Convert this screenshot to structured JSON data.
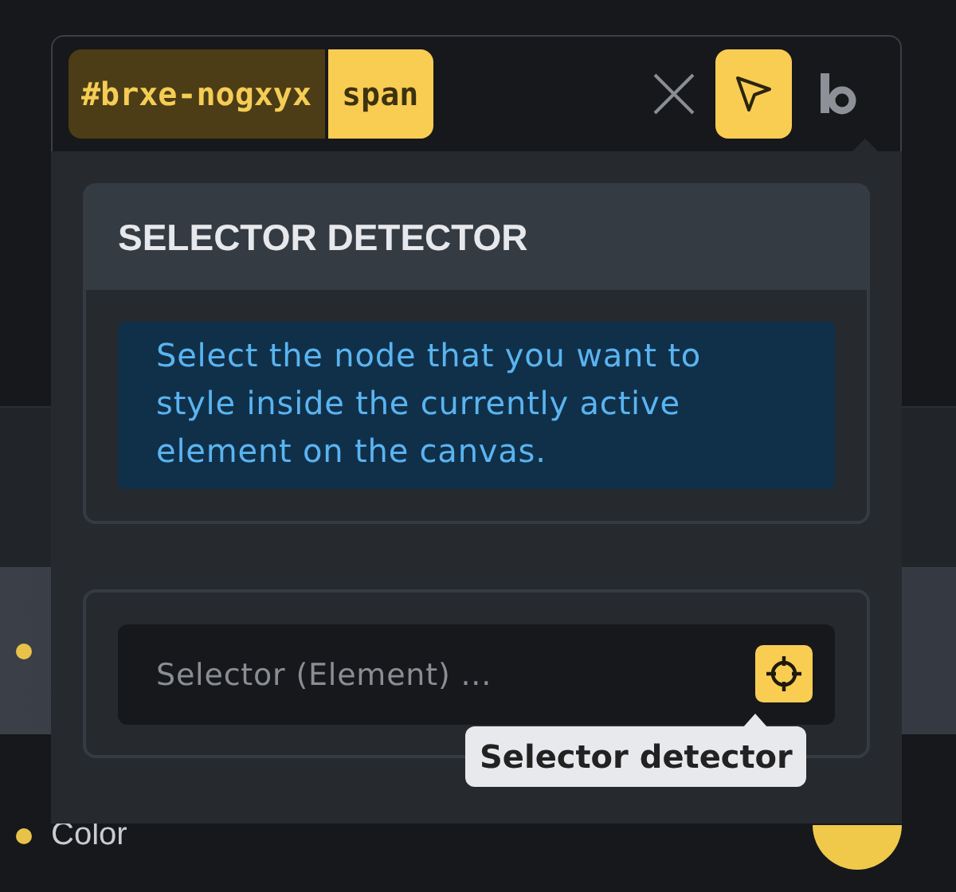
{
  "selector_bar": {
    "id_chip": "#brxe-nogxyx",
    "tag_chip": "span",
    "picker_active": true
  },
  "popup": {
    "title": "SELECTOR DETECTOR",
    "info": "Select the node that you want to style inside the currently active element on the canvas.",
    "selector_field": {
      "placeholder": "Selector (Element) ..."
    },
    "tooltip": "Selector detector"
  },
  "background": {
    "control_label": "Color"
  }
}
